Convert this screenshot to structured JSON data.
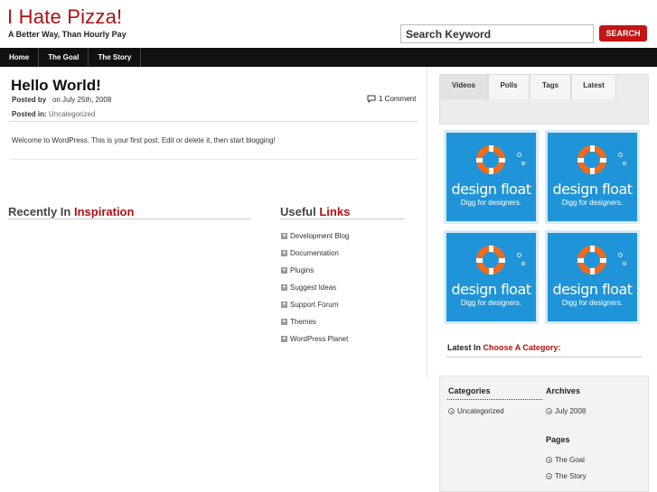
{
  "site": {
    "title": "I Hate Pizza!",
    "tagline": "A Better Way, Than Hourly Pay"
  },
  "search": {
    "value": "Search Keyword",
    "button_label": "SEARCH"
  },
  "nav": {
    "items": [
      {
        "label": "Home"
      },
      {
        "label": "The Goal"
      },
      {
        "label": "The Story"
      }
    ]
  },
  "post": {
    "title": "Hello World!",
    "posted_by_label": "Posted by",
    "date": "on July 25th, 2008",
    "comments": "1 Comment",
    "posted_in_label": "Posted in:",
    "category": "Uncategorized",
    "body": "Welcome to WordPress. This is your first post. Edit or delete it, then start blogging!"
  },
  "recent": {
    "prefix": "Recently In",
    "accent": "Inspiration"
  },
  "useful_links": {
    "prefix": "Useful",
    "accent": "Links",
    "items": [
      {
        "label": "Development Blog"
      },
      {
        "label": "Documentation"
      },
      {
        "label": "Plugins"
      },
      {
        "label": "Suggest Ideas"
      },
      {
        "label": "Support Forum"
      },
      {
        "label": "Themes"
      },
      {
        "label": "WordPress Planet"
      }
    ]
  },
  "sidebar": {
    "tabs": [
      {
        "label": "Videos"
      },
      {
        "label": "Polls"
      },
      {
        "label": "Tags"
      },
      {
        "label": "Latest"
      }
    ],
    "ads": [
      {
        "title": "design float",
        "subtitle": "Digg for designers."
      },
      {
        "title": "design float",
        "subtitle": "Digg for designers."
      },
      {
        "title": "design float",
        "subtitle": "Digg for designers."
      },
      {
        "title": "design float",
        "subtitle": "Digg for designers."
      }
    ],
    "latest_in": {
      "prefix": "Latest In",
      "accent": "Choose A Category:"
    },
    "categories": {
      "heading": "Categories",
      "items": [
        {
          "label": "Uncategorized"
        }
      ]
    },
    "archives": {
      "heading": "Archives",
      "items": [
        {
          "label": "July 2008"
        }
      ]
    },
    "pages": {
      "heading": "Pages",
      "items": [
        {
          "label": "The Goal"
        },
        {
          "label": "The Story"
        }
      ]
    }
  },
  "colors": {
    "accent": "#b01010",
    "nav_bg": "#111111",
    "search_button": "#c41414",
    "ad_bg": "#2094d8",
    "buoy": "#f26a1b"
  },
  "icons": {
    "comment": "comment-icon",
    "link_bullet": "plus-icon",
    "widget_bullet": "circle-bullet-icon"
  }
}
